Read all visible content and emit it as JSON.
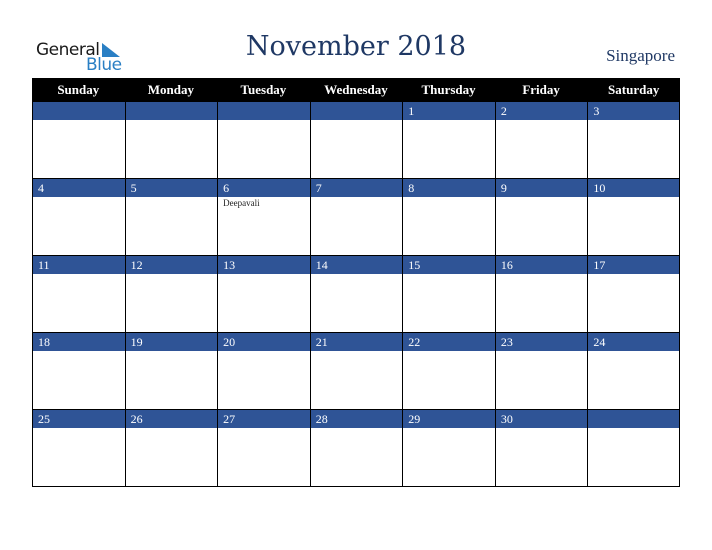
{
  "logo": {
    "word1": "General",
    "word2": "Blue"
  },
  "title": "November 2018",
  "country": "Singapore",
  "colors": {
    "header_bg": "#000000",
    "band_bg": "#2f5496",
    "title": "#1f3864",
    "logo_blue": "#2a7fc4"
  },
  "weekdays": [
    "Sunday",
    "Monday",
    "Tuesday",
    "Wednesday",
    "Thursday",
    "Friday",
    "Saturday"
  ],
  "weeks": [
    {
      "days": [
        {
          "num": "",
          "event": ""
        },
        {
          "num": "",
          "event": ""
        },
        {
          "num": "",
          "event": ""
        },
        {
          "num": "",
          "event": ""
        },
        {
          "num": "1",
          "event": ""
        },
        {
          "num": "2",
          "event": ""
        },
        {
          "num": "3",
          "event": ""
        }
      ]
    },
    {
      "days": [
        {
          "num": "4",
          "event": ""
        },
        {
          "num": "5",
          "event": ""
        },
        {
          "num": "6",
          "event": "Deepavali"
        },
        {
          "num": "7",
          "event": ""
        },
        {
          "num": "8",
          "event": ""
        },
        {
          "num": "9",
          "event": ""
        },
        {
          "num": "10",
          "event": ""
        }
      ]
    },
    {
      "days": [
        {
          "num": "11",
          "event": ""
        },
        {
          "num": "12",
          "event": ""
        },
        {
          "num": "13",
          "event": ""
        },
        {
          "num": "14",
          "event": ""
        },
        {
          "num": "15",
          "event": ""
        },
        {
          "num": "16",
          "event": ""
        },
        {
          "num": "17",
          "event": ""
        }
      ]
    },
    {
      "days": [
        {
          "num": "18",
          "event": ""
        },
        {
          "num": "19",
          "event": ""
        },
        {
          "num": "20",
          "event": ""
        },
        {
          "num": "21",
          "event": ""
        },
        {
          "num": "22",
          "event": ""
        },
        {
          "num": "23",
          "event": ""
        },
        {
          "num": "24",
          "event": ""
        }
      ]
    },
    {
      "days": [
        {
          "num": "25",
          "event": ""
        },
        {
          "num": "26",
          "event": ""
        },
        {
          "num": "27",
          "event": ""
        },
        {
          "num": "28",
          "event": ""
        },
        {
          "num": "29",
          "event": ""
        },
        {
          "num": "30",
          "event": ""
        },
        {
          "num": "",
          "event": ""
        }
      ]
    }
  ]
}
